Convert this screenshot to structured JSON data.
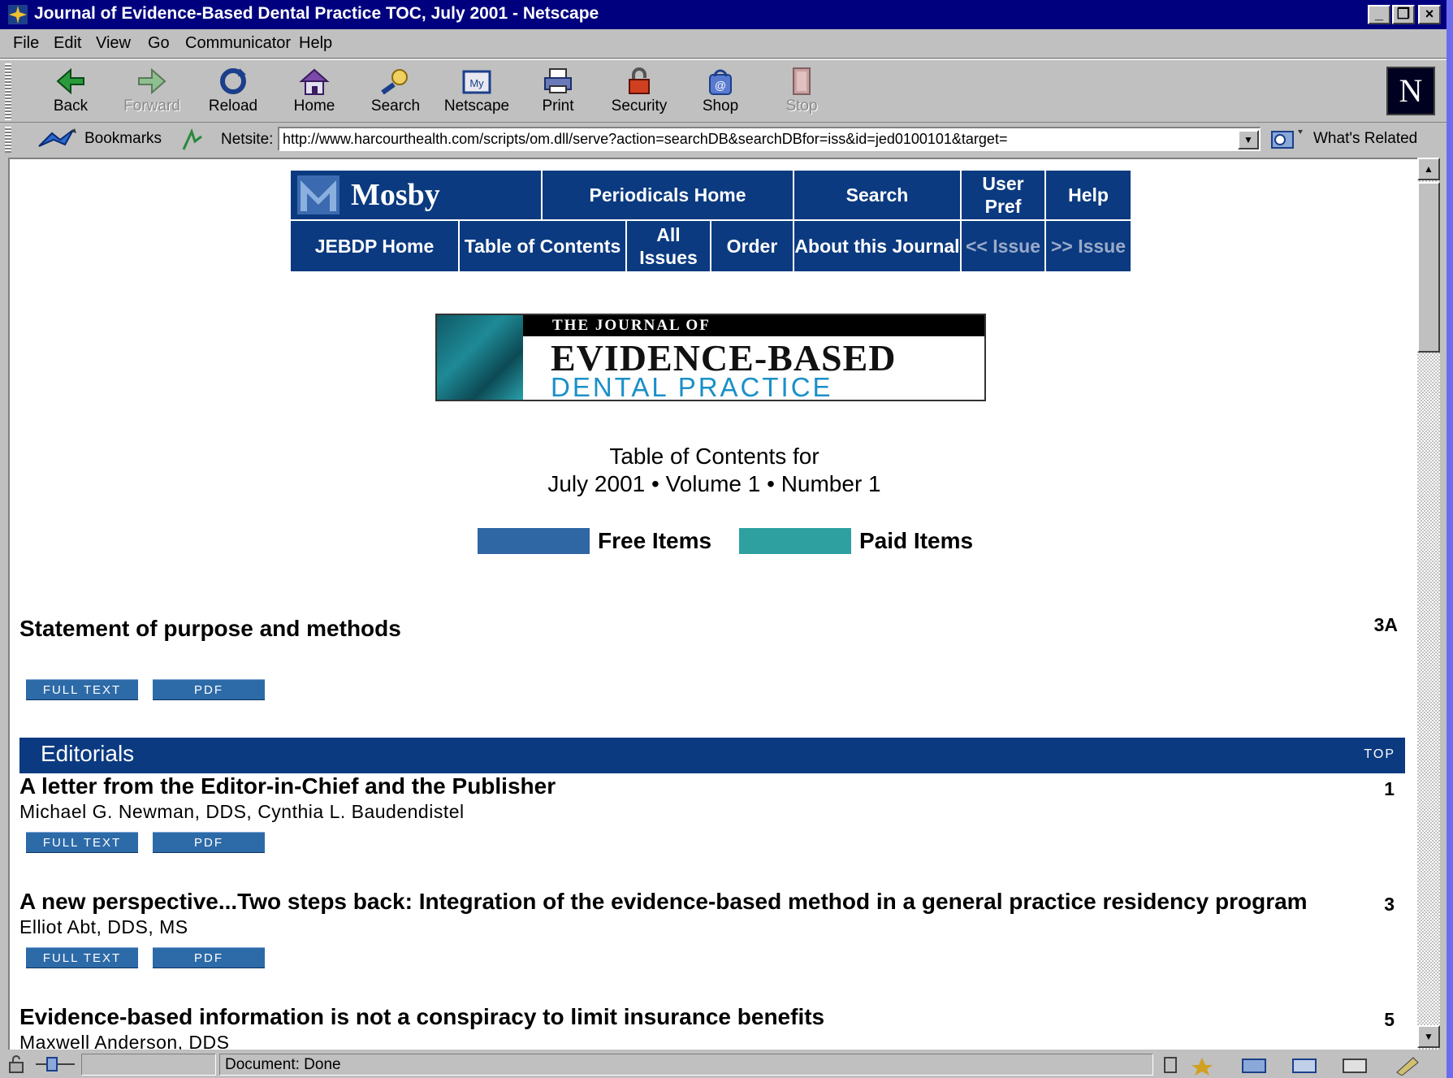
{
  "window": {
    "title": "Journal of Evidence-Based Dental Practice TOC, July 2001 - Netscape"
  },
  "menu": [
    "File",
    "Edit",
    "View",
    "Go",
    "Communicator",
    "Help"
  ],
  "toolbar": {
    "back": "Back",
    "forward": "Forward",
    "reload": "Reload",
    "home": "Home",
    "search": "Search",
    "netscape": "Netscape",
    "print": "Print",
    "security": "Security",
    "shop": "Shop",
    "stop": "Stop"
  },
  "location": {
    "bookmarks": "Bookmarks",
    "label": "Netsite:",
    "url": "http://www.harcourthealth.com/scripts/om.dll/serve?action=searchDB&searchDBfor=iss&id=jed0100101&target=",
    "whats_related": "What's Related"
  },
  "site_nav": {
    "brand": "Mosby",
    "periodicals_home": "Periodicals Home",
    "search": "Search",
    "user_pref": "User Pref",
    "help": "Help",
    "jebdp_home": "JEBDP Home",
    "table_of_contents": "Table of Contents",
    "all_issues": "All Issues",
    "order": "Order",
    "about": "About this Journal",
    "prev_issue": "<< Issue",
    "next_issue": ">> Issue"
  },
  "banner": {
    "line1": "THE JOURNAL OF",
    "line2": "EVIDENCE-BASED",
    "line3": "DENTAL PRACTICE"
  },
  "toc": {
    "heading": "Table of Contents for",
    "issue": "July 2001 • Volume 1 • Number 1"
  },
  "legend": {
    "free": "Free Items",
    "paid": "Paid Items",
    "free_color": "#2f66a4",
    "paid_color": "#2fa0a0"
  },
  "buttons": {
    "full_text": "FULL TEXT",
    "pdf": "PDF"
  },
  "statement": {
    "title": "Statement of purpose and methods",
    "page": "3A"
  },
  "section": {
    "title": "Editorials",
    "top": "TOP"
  },
  "articles": [
    {
      "title": "A letter from the Editor-in-Chief and the Publisher",
      "authors": "Michael G. Newman, DDS, Cynthia L. Baudendistel",
      "page": "1"
    },
    {
      "title": "A new perspective...Two steps back: Integration of the evidence-based method in a general practice residency program",
      "authors": "Elliot Abt, DDS, MS",
      "page": "3"
    },
    {
      "title": "Evidence-based information is not a conspiracy to limit insurance benefits",
      "authors": "Maxwell Anderson, DDS",
      "page": "5"
    }
  ],
  "status": {
    "text": "Document: Done"
  }
}
